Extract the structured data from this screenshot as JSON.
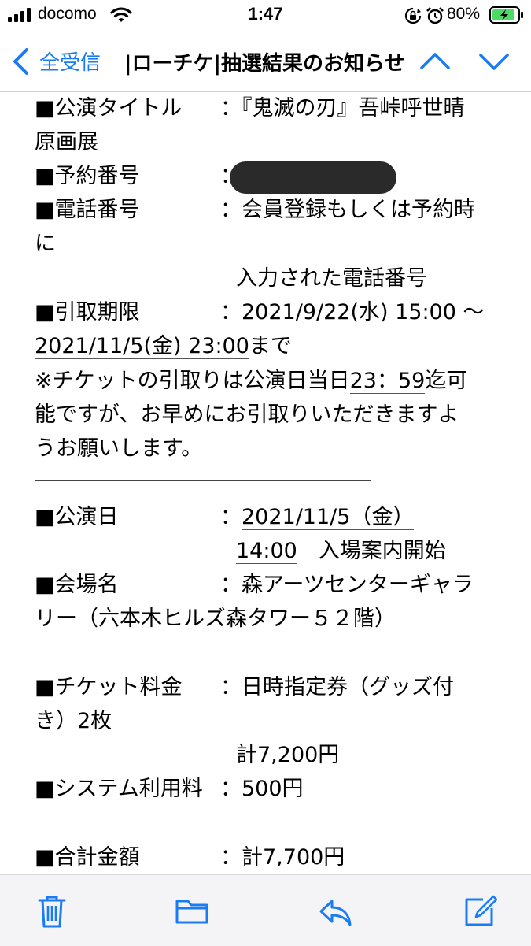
{
  "status_bar": {
    "carrier": "docomo",
    "time": "1:47",
    "battery_percent": "80%"
  },
  "nav": {
    "back_label": "全受信",
    "title": "|ローチケ|抽選結果のお知らせ"
  },
  "email": {
    "lines": {
      "title_label": "■公演タイトル",
      "title_value": "：『鬼滅の刃』吾峠呼世晴",
      "title_cont": "原画展",
      "reservation_label": "■予約番号",
      "reservation_colon": "：",
      "phone_label": "■電話番号",
      "phone_value": "：会員登録もしくは予約時",
      "phone_cont": "に",
      "phone_cont2": "入力された電話番号",
      "pickup_label": "■引取期限",
      "pickup_colon": "：",
      "pickup_start": "2021/9/22(水) 15:00 ～",
      "pickup_end": "2021/11/5(金) 23:00",
      "pickup_end_suffix": "まで",
      "note_1a": "※チケットの引取りは公演日当日",
      "note_1b": "23：59",
      "note_1c": "迄可",
      "note_2": "能ですが、お早めにお引取りいただきますよ",
      "note_3": "うお願いします。",
      "date_label": "■公演日",
      "date_colon": "：",
      "date_value": "2021/11/5（金）",
      "time_value": "14:00",
      "time_suffix": "　入場案内開始",
      "venue_label": "■会場名",
      "venue_value": "：森アーツセンターギャラ",
      "venue_cont": "リー（六本木ヒルズ森タワー５２階）",
      "fee_label": "■チケット料金",
      "fee_value": "：日時指定券（グッズ付",
      "fee_cont": "き）2枚",
      "fee_total": "計7,200円",
      "system_label": "■システム利用料",
      "system_value": "：500円",
      "total_label": "■合計金額",
      "total_value": "：計7,700円"
    }
  },
  "colors": {
    "accent": "#1a7cf5",
    "battery_green": "#4cd964",
    "redaction": "#2a2a2a"
  },
  "icons": [
    "signal-icon",
    "wifi-icon",
    "rotation-lock-icon",
    "alarm-icon",
    "battery-icon",
    "back-chevron-icon",
    "chevron-up-icon",
    "chevron-down-icon",
    "trash-icon",
    "folder-icon",
    "reply-icon",
    "compose-icon"
  ]
}
